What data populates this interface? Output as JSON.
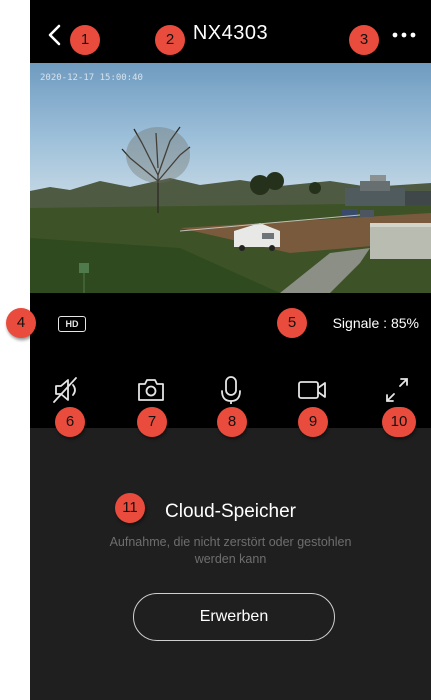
{
  "header": {
    "title": "NX4303"
  },
  "video": {
    "timestamp": "2020-12-17 15:00:40"
  },
  "status": {
    "quality_badge": "HD",
    "signal_text": "Signale : 85%"
  },
  "controls": [
    {
      "name": "mute-speaker-icon"
    },
    {
      "name": "camera-snapshot-icon"
    },
    {
      "name": "microphone-icon"
    },
    {
      "name": "video-record-icon"
    },
    {
      "name": "fullscreen-icon"
    }
  ],
  "cloud": {
    "title": "Cloud-Speicher",
    "description": "Aufnahme, die nicht zerstört oder gestohlen werden kann",
    "buy_label": "Erwerben"
  },
  "markers": [
    "1",
    "2",
    "3",
    "4",
    "5",
    "6",
    "7",
    "8",
    "9",
    "10",
    "11"
  ],
  "colors": {
    "marker": "#e94b3c",
    "background": "#000000",
    "panel": "#1f1f1f"
  }
}
